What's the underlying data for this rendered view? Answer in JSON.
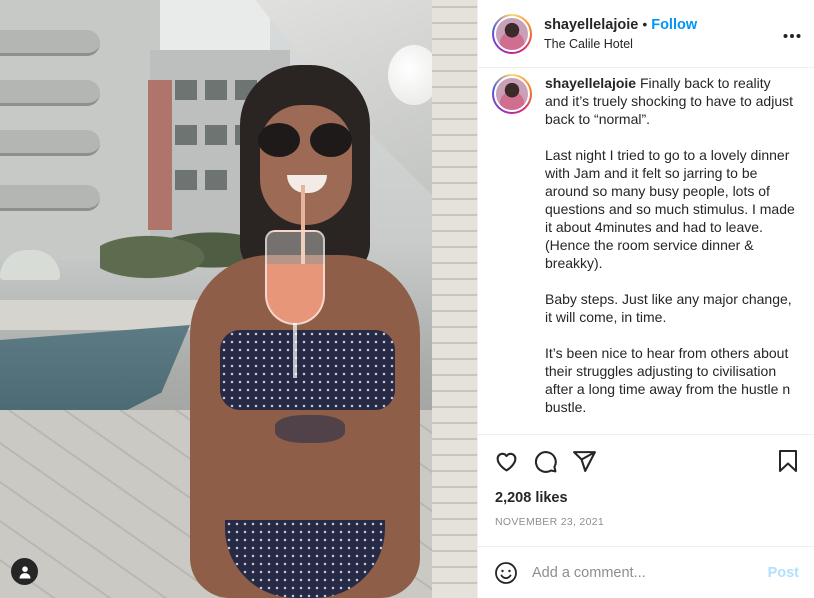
{
  "post": {
    "username": "shayellelajoie",
    "separator": "•",
    "follow_label": "Follow",
    "location": "The Calile Hotel",
    "more_icon": "more-options-icon",
    "caption": {
      "username": "shayellelajoie",
      "paragraphs": [
        "Finally back to reality and it’s truely shocking to have to adjust back to “normal”.",
        "Last night I tried to go to a lovely dinner with Jam and it felt so jarring to be around so many busy people, lots of questions and so much stimulus. I made it about 4minutes and had to leave. (Hence the room service dinner & breakky).",
        "Baby steps. Just like any major change, it will come, in time.",
        "It’s been nice to hear from others about their struggles adjusting to civilisation after a long time away from the hustle n bustle."
      ]
    },
    "likes": "2,208 likes",
    "date": "NOVEMBER 23, 2021"
  },
  "actions": {
    "like_icon": "heart-icon",
    "comment_icon": "comment-icon",
    "share_icon": "share-icon",
    "save_icon": "bookmark-icon"
  },
  "comment": {
    "placeholder": "Add a comment...",
    "post_label": "Post",
    "emoji_icon": "emoji-icon"
  },
  "photo": {
    "tag_icon": "user-tag-icon"
  },
  "colors": {
    "accent": "#0095f6",
    "post_disabled": "#b2dffc",
    "muted": "#8e8e8e",
    "text": "#262626"
  }
}
